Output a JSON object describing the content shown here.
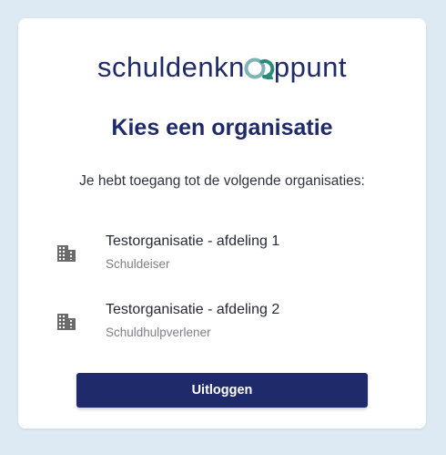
{
  "logo": {
    "text_before": "schuldenkn",
    "text_after": "ppunt",
    "mark_icon": "linked-chat-bubbles-icon",
    "colors": {
      "text": "#1f2a6b",
      "mark_light": "#7fb3b5",
      "mark_dark": "#2f8a7d"
    }
  },
  "title": "Kies een organisatie",
  "subtitle": "Je hebt toegang tot de volgende organisaties:",
  "organisations": [
    {
      "name": "Testorganisatie - afdeling 1",
      "role": "Schuldeiser",
      "icon": "building-icon"
    },
    {
      "name": "Testorganisatie - afdeling 2",
      "role": "Schuldhulpverlener",
      "icon": "building-icon"
    }
  ],
  "logout_button": {
    "label": "Uitloggen"
  },
  "colors": {
    "primary": "#1f2a6b",
    "background": "#dde9f3",
    "card": "#ffffff"
  }
}
